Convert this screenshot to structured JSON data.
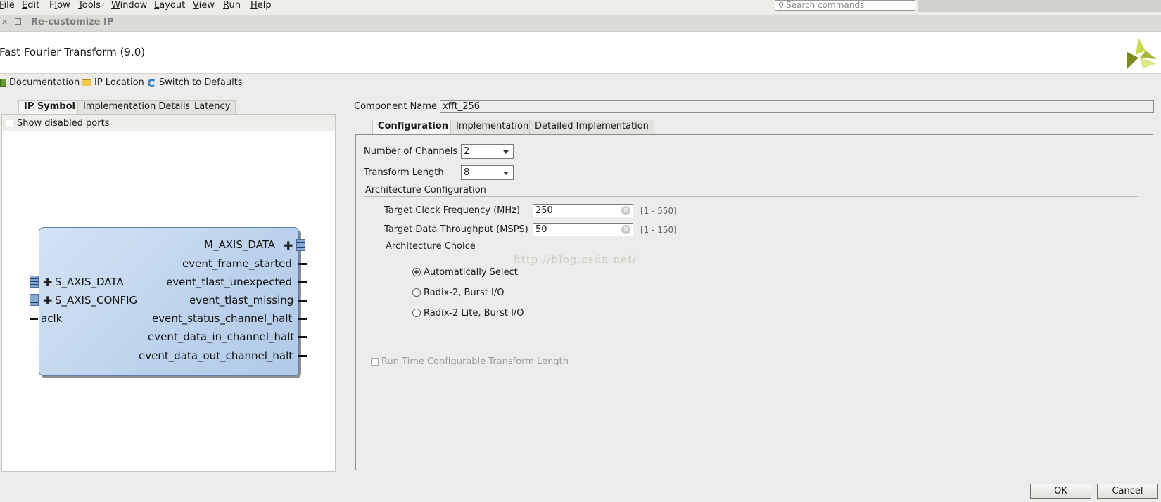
{
  "menu": {
    "items": [
      "File",
      "Edit",
      "Flow",
      "Tools",
      "Window",
      "Layout",
      "View",
      "Run",
      "Help"
    ],
    "underline": [
      "F",
      "E",
      "l",
      "T",
      "W",
      "L",
      "V",
      "R",
      "H"
    ],
    "search_placeholder": "Search commands"
  },
  "dialog": {
    "title": "Re-customize IP",
    "header_title": "Fast Fourier Transform (9.0)"
  },
  "toolbar": {
    "documentation": "Documentation",
    "ip_location": "IP Location",
    "switch_defaults": "Switch to Defaults"
  },
  "left": {
    "tabs": [
      "IP Symbol",
      "Implementation Details",
      "Latency"
    ],
    "show_disabled_ports": "Show disabled ports",
    "ports_right": [
      "M_AXIS_DATA",
      "event_frame_started",
      "event_tlast_unexpected",
      "event_tlast_missing",
      "event_status_channel_halt",
      "event_data_in_channel_halt",
      "event_data_out_channel_halt"
    ],
    "ports_left": [
      "S_AXIS_DATA",
      "S_AXIS_CONFIG",
      "aclk"
    ]
  },
  "right": {
    "component_name_label": "Component Name",
    "component_name_value": "xfft_256",
    "tabs": [
      "Configuration",
      "Implementation",
      "Detailed Implementation"
    ],
    "num_channels_label": "Number of Channels",
    "num_channels_value": "2",
    "transform_length_label": "Transform Length",
    "transform_length_value": "8",
    "arch_config_label": "Architecture Configuration",
    "clock_label": "Target Clock Frequency (MHz)",
    "clock_value": "250",
    "clock_range": "[1 - 550]",
    "throughput_label": "Target Data Throughput (MSPS)",
    "throughput_value": "50",
    "throughput_range": "[1 - 150]",
    "arch_choice_label": "Architecture Choice",
    "watermark": "http://blog.csdn.net/",
    "radio_auto": "Automatically Select",
    "radio_radix2": "Radix-2, Burst I/O",
    "radio_radix2lite": "Radix-2 Lite, Burst I/O",
    "runtime_config": "Run Time Configurable Transform Length"
  },
  "buttons": {
    "ok": "OK",
    "cancel": "Cancel"
  }
}
